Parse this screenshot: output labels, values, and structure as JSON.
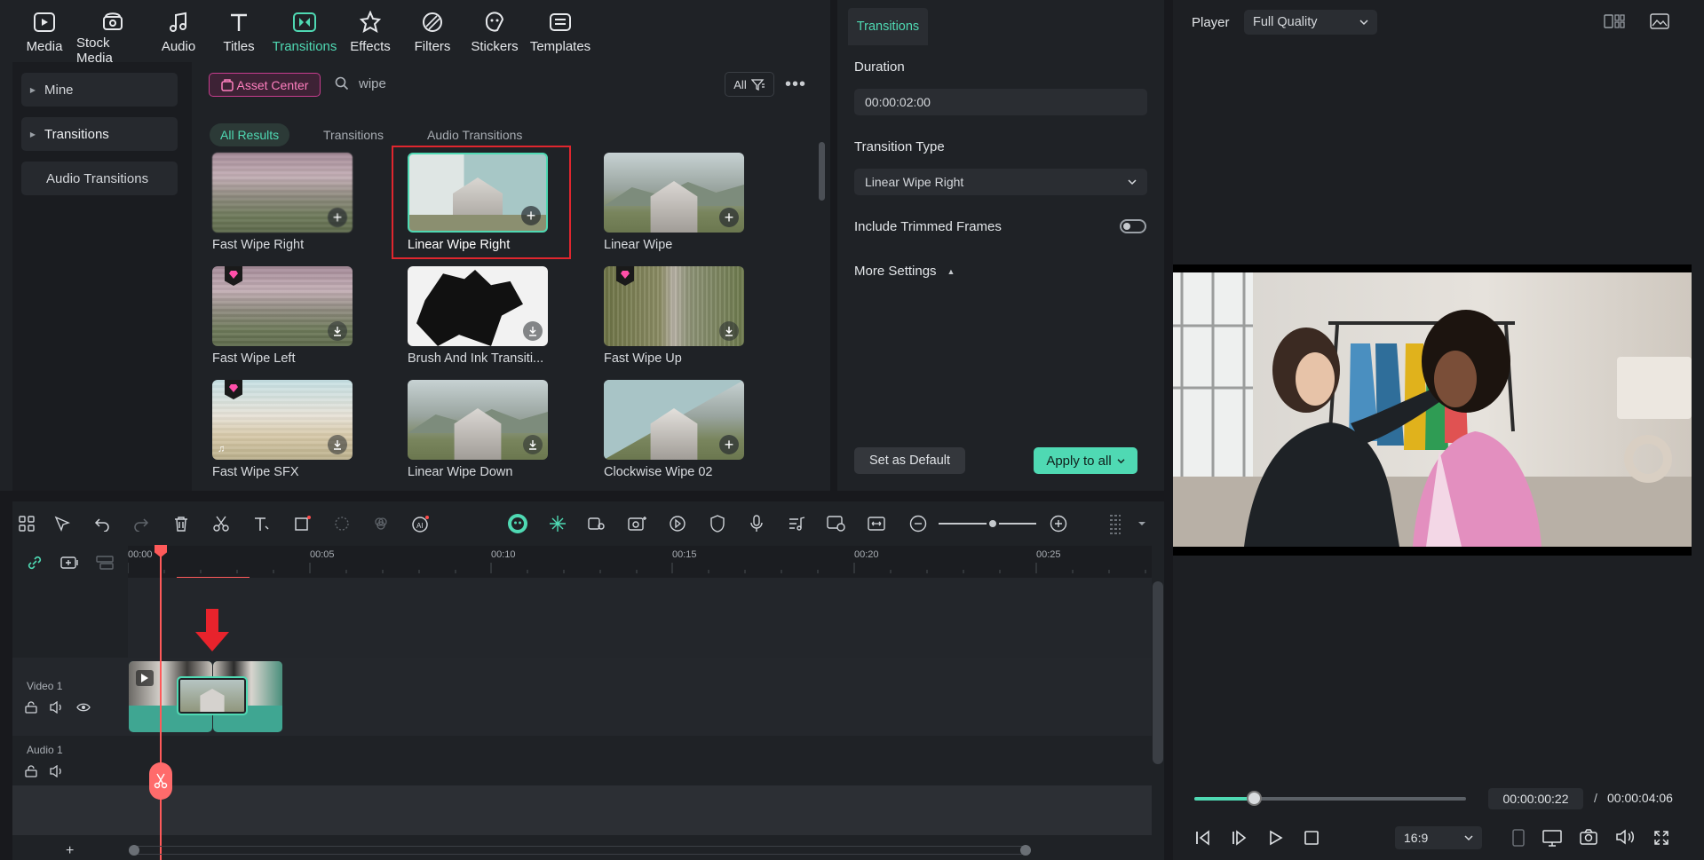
{
  "categories": [
    {
      "label": "Media",
      "icon": "media-icon"
    },
    {
      "label": "Stock Media",
      "icon": "stock-media-icon"
    },
    {
      "label": "Audio",
      "icon": "audio-icon"
    },
    {
      "label": "Titles",
      "icon": "titles-icon"
    },
    {
      "label": "Transitions",
      "icon": "transitions-icon",
      "active": true
    },
    {
      "label": "Effects",
      "icon": "effects-icon"
    },
    {
      "label": "Filters",
      "icon": "filters-icon"
    },
    {
      "label": "Stickers",
      "icon": "stickers-icon"
    },
    {
      "label": "Templates",
      "icon": "templates-icon"
    }
  ],
  "sidebar": {
    "items": [
      {
        "label": "Mine"
      },
      {
        "label": "Transitions"
      },
      {
        "label": "Audio Transitions"
      }
    ]
  },
  "library": {
    "asset_center": "Asset Center",
    "search_value": "wipe",
    "filter_label": "All",
    "subtabs": [
      {
        "label": "All Results"
      },
      {
        "label": "Transitions"
      },
      {
        "label": "Audio Transitions"
      }
    ],
    "items": [
      {
        "label": "Fast Wipe Right"
      },
      {
        "label": "Linear Wipe Right"
      },
      {
        "label": "Linear Wipe"
      },
      {
        "label": "Fast Wipe Left"
      },
      {
        "label": "Brush And Ink Transiti..."
      },
      {
        "label": "Fast Wipe Up"
      },
      {
        "label": "Fast Wipe SFX"
      },
      {
        "label": "Linear Wipe Down"
      },
      {
        "label": "Clockwise Wipe 02"
      }
    ]
  },
  "transition_panel": {
    "tab": "Transitions",
    "duration_label": "Duration",
    "duration_value": "00:00:02:00",
    "type_label": "Transition Type",
    "type_value": "Linear Wipe Right",
    "trim_label": "Include Trimmed Frames",
    "more_label": "More Settings",
    "set_default": "Set as Default",
    "apply_all": "Apply to all"
  },
  "player": {
    "label": "Player",
    "quality": "Full Quality",
    "current_time": "00:00:00:22",
    "separator": "/",
    "total_time": "00:00:04:06",
    "aspect": "16:9",
    "progress": 0.22
  },
  "timeline": {
    "ticks": [
      "00:00",
      "00:05",
      "00:10",
      "00:15",
      "00:20",
      "00:25"
    ],
    "video_track": "Video 1",
    "audio_track": "Audio 1",
    "add_track": "+"
  },
  "colors": {
    "accent": "#4fd9b3",
    "asset": "#ff7fbf",
    "highlight": "#e0262e",
    "playhead": "#ff5a5a"
  }
}
